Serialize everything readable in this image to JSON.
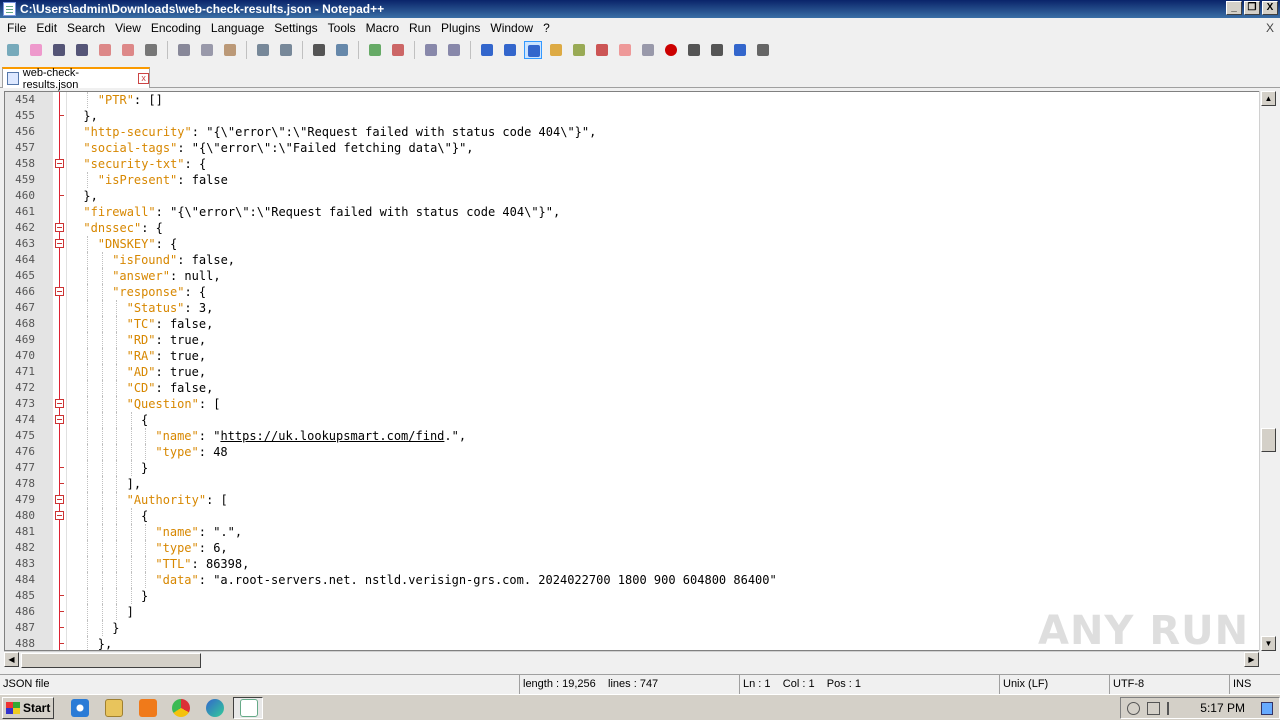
{
  "window": {
    "title": "C:\\Users\\admin\\Downloads\\web-check-results.json - Notepad++",
    "buttons": [
      "_",
      "❐",
      "X"
    ]
  },
  "menu": [
    "File",
    "Edit",
    "Search",
    "View",
    "Encoding",
    "Language",
    "Settings",
    "Tools",
    "Macro",
    "Run",
    "Plugins",
    "Window",
    "?"
  ],
  "menu_close": "X",
  "tab": {
    "label": "web-check-results.json",
    "close": "x"
  },
  "status": {
    "filetype": "JSON file",
    "length": "length : 19,256",
    "lines": "lines : 747",
    "ln": "Ln : 1",
    "col": "Col : 1",
    "pos": "Pos : 1",
    "eol": "Unix (LF)",
    "encoding": "UTF-8",
    "mode": "INS"
  },
  "taskbar": {
    "start": "Start",
    "clock": "5:17 PM"
  },
  "watermark": "ANY RUN",
  "lines": [
    {
      "n": "454",
      "fold": "",
      "indent": 2,
      "parts": [
        [
          "k",
          "\"PTR\""
        ],
        [
          "p",
          ": []"
        ]
      ]
    },
    {
      "n": "455",
      "fold": "end",
      "indent": 1,
      "parts": [
        [
          "p",
          "},"
        ]
      ]
    },
    {
      "n": "456",
      "fold": "",
      "indent": 1,
      "parts": [
        [
          "k",
          "\"http-security\""
        ],
        [
          "p",
          ": \"{\\\"error\\\":\\\"Request failed with status code 404\\\"}\","
        ]
      ]
    },
    {
      "n": "457",
      "fold": "",
      "indent": 1,
      "parts": [
        [
          "k",
          "\"social-tags\""
        ],
        [
          "p",
          ": \"{\\\"error\\\":\\\"Failed fetching data\\\"}\","
        ]
      ]
    },
    {
      "n": "458",
      "fold": "open",
      "indent": 1,
      "parts": [
        [
          "k",
          "\"security-txt\""
        ],
        [
          "p",
          ": {"
        ]
      ]
    },
    {
      "n": "459",
      "fold": "",
      "indent": 2,
      "parts": [
        [
          "k",
          "\"isPresent\""
        ],
        [
          "p",
          ": false"
        ]
      ]
    },
    {
      "n": "460",
      "fold": "end",
      "indent": 1,
      "parts": [
        [
          "p",
          "},"
        ]
      ]
    },
    {
      "n": "461",
      "fold": "",
      "indent": 1,
      "parts": [
        [
          "k",
          "\"firewall\""
        ],
        [
          "p",
          ": \"{\\\"error\\\":\\\"Request failed with status code 404\\\"}\","
        ]
      ]
    },
    {
      "n": "462",
      "fold": "open",
      "indent": 1,
      "parts": [
        [
          "k",
          "\"dnssec\""
        ],
        [
          "p",
          ": {"
        ]
      ]
    },
    {
      "n": "463",
      "fold": "open",
      "indent": 2,
      "parts": [
        [
          "k",
          "\"DNSKEY\""
        ],
        [
          "p",
          ": {"
        ]
      ]
    },
    {
      "n": "464",
      "fold": "",
      "indent": 3,
      "parts": [
        [
          "k",
          "\"isFound\""
        ],
        [
          "p",
          ": false,"
        ]
      ]
    },
    {
      "n": "465",
      "fold": "",
      "indent": 3,
      "parts": [
        [
          "k",
          "\"answer\""
        ],
        [
          "p",
          ": null,"
        ]
      ]
    },
    {
      "n": "466",
      "fold": "open",
      "indent": 3,
      "parts": [
        [
          "k",
          "\"response\""
        ],
        [
          "p",
          ": {"
        ]
      ]
    },
    {
      "n": "467",
      "fold": "",
      "indent": 4,
      "parts": [
        [
          "k",
          "\"Status\""
        ],
        [
          "p",
          ": 3,"
        ]
      ]
    },
    {
      "n": "468",
      "fold": "",
      "indent": 4,
      "parts": [
        [
          "k",
          "\"TC\""
        ],
        [
          "p",
          ": false,"
        ]
      ]
    },
    {
      "n": "469",
      "fold": "",
      "indent": 4,
      "parts": [
        [
          "k",
          "\"RD\""
        ],
        [
          "p",
          ": true,"
        ]
      ]
    },
    {
      "n": "470",
      "fold": "",
      "indent": 4,
      "parts": [
        [
          "k",
          "\"RA\""
        ],
        [
          "p",
          ": true,"
        ]
      ]
    },
    {
      "n": "471",
      "fold": "",
      "indent": 4,
      "parts": [
        [
          "k",
          "\"AD\""
        ],
        [
          "p",
          ": true,"
        ]
      ]
    },
    {
      "n": "472",
      "fold": "",
      "indent": 4,
      "parts": [
        [
          "k",
          "\"CD\""
        ],
        [
          "p",
          ": false,"
        ]
      ]
    },
    {
      "n": "473",
      "fold": "open",
      "indent": 4,
      "parts": [
        [
          "k",
          "\"Question\""
        ],
        [
          "p",
          ": ["
        ]
      ]
    },
    {
      "n": "474",
      "fold": "open",
      "indent": 5,
      "parts": [
        [
          "p",
          "{"
        ]
      ]
    },
    {
      "n": "475",
      "fold": "",
      "indent": 6,
      "parts": [
        [
          "k",
          "\"name\""
        ],
        [
          "p",
          ": \""
        ],
        [
          "u",
          "https://uk.lookupsmart.com/find"
        ],
        [
          "p",
          ".\","
        ]
      ]
    },
    {
      "n": "476",
      "fold": "",
      "indent": 6,
      "parts": [
        [
          "k",
          "\"type\""
        ],
        [
          "p",
          ": 48"
        ]
      ]
    },
    {
      "n": "477",
      "fold": "end",
      "indent": 5,
      "parts": [
        [
          "p",
          "}"
        ]
      ]
    },
    {
      "n": "478",
      "fold": "end",
      "indent": 4,
      "parts": [
        [
          "p",
          "],"
        ]
      ]
    },
    {
      "n": "479",
      "fold": "open",
      "indent": 4,
      "parts": [
        [
          "k",
          "\"Authority\""
        ],
        [
          "p",
          ": ["
        ]
      ]
    },
    {
      "n": "480",
      "fold": "open",
      "indent": 5,
      "parts": [
        [
          "p",
          "{"
        ]
      ]
    },
    {
      "n": "481",
      "fold": "",
      "indent": 6,
      "parts": [
        [
          "k",
          "\"name\""
        ],
        [
          "p",
          ": \".\","
        ]
      ]
    },
    {
      "n": "482",
      "fold": "",
      "indent": 6,
      "parts": [
        [
          "k",
          "\"type\""
        ],
        [
          "p",
          ": 6,"
        ]
      ]
    },
    {
      "n": "483",
      "fold": "",
      "indent": 6,
      "parts": [
        [
          "k",
          "\"TTL\""
        ],
        [
          "p",
          ": 86398,"
        ]
      ]
    },
    {
      "n": "484",
      "fold": "",
      "indent": 6,
      "parts": [
        [
          "k",
          "\"data\""
        ],
        [
          "p",
          ": \"a.root-servers.net. nstld.verisign-grs.com. 2024022700 1800 900 604800 86400\""
        ]
      ]
    },
    {
      "n": "485",
      "fold": "end",
      "indent": 5,
      "parts": [
        [
          "p",
          "}"
        ]
      ]
    },
    {
      "n": "486",
      "fold": "end",
      "indent": 4,
      "parts": [
        [
          "p",
          "]"
        ]
      ]
    },
    {
      "n": "487",
      "fold": "end",
      "indent": 3,
      "parts": [
        [
          "p",
          "}"
        ]
      ]
    },
    {
      "n": "488",
      "fold": "end",
      "indent": 2,
      "parts": [
        [
          "p",
          "},"
        ]
      ]
    }
  ],
  "colors": {
    "key": "#d78700",
    "fold": "#cc3333",
    "titlebar": "#0a246a"
  },
  "toolbar_icons": [
    "new-file-icon",
    "open-file-icon",
    "save-icon",
    "save-all-icon",
    "close-icon",
    "close-all-icon",
    "print-icon",
    "cut-icon",
    "copy-icon",
    "paste-icon",
    "undo-icon",
    "redo-icon",
    "find-icon",
    "replace-icon",
    "zoom-in-icon",
    "zoom-out-icon",
    "sync-v-icon",
    "sync-h-icon",
    "wrap-icon",
    "all-chars-icon",
    "indent-guide-icon",
    "udl-icon",
    "doc-map-icon",
    "function-list-icon",
    "folder-workspace-icon",
    "monitor-icon",
    "record-macro-icon",
    "stop-macro-icon",
    "play-macro-icon",
    "play-multi-icon",
    "save-macro-icon"
  ]
}
